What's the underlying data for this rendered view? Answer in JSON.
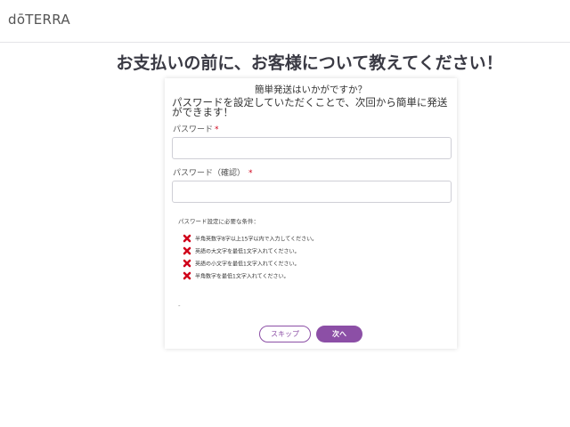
{
  "header": {
    "logo_text": "dōTERRA"
  },
  "page": {
    "headline": "お支払いの前に、お客様について教えてください！"
  },
  "form": {
    "title": "簡単発送はいかがですか？",
    "description": "パスワードを設定していただくことで、次回から簡単に発送ができます！",
    "password_label": "パスワード",
    "password_value": "",
    "confirm_label": "パスワード（確認）",
    "confirm_value": "",
    "required_mark": "*",
    "requirements_title": "パスワード設定に必要な条件：",
    "requirements": [
      "半角英数字8字以上15字以内で入力してください。",
      "英語の大文字を最低1文字入れてください。",
      "英語の小文字を最低1文字入れてください。",
      "半角数字を最低1文字入れてください。"
    ],
    "requirement_icon": "red-x-icon",
    "requirement_icon_color": "#d0021b",
    "dash_text": "-",
    "skip_label": "スキップ",
    "next_label": "次へ",
    "accent_color": "#8c4fa6"
  }
}
